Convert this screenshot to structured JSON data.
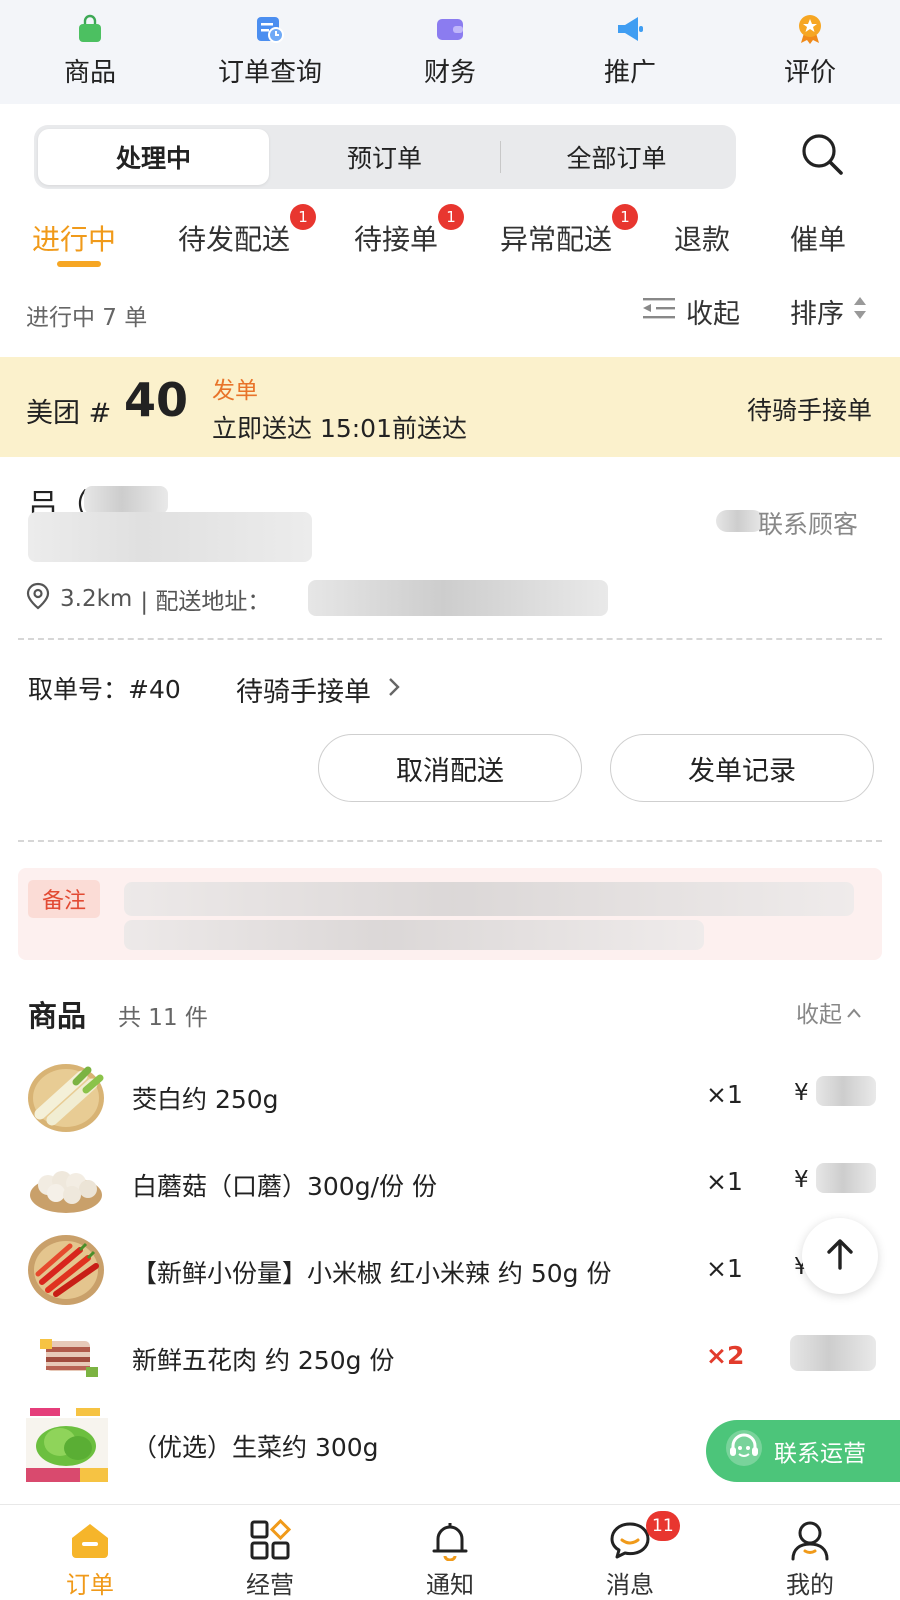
{
  "top_nav": [
    {
      "label": "商品",
      "icon": "bag-icon",
      "color": "#4cc061"
    },
    {
      "label": "订单查询",
      "icon": "order-search-icon",
      "color": "#4b8ef0"
    },
    {
      "label": "财务",
      "icon": "wallet-icon",
      "color": "#8b7cf0"
    },
    {
      "label": "推广",
      "icon": "megaphone-icon",
      "color": "#3f9df2"
    },
    {
      "label": "评价",
      "icon": "star-medal-icon",
      "color": "#f6a623"
    }
  ],
  "segment": {
    "items": [
      "处理中",
      "预订单",
      "全部订单"
    ],
    "active": "处理中"
  },
  "status_tabs": [
    {
      "label": "进行中",
      "badge": "",
      "active": true
    },
    {
      "label": "待发配送",
      "badge": "1"
    },
    {
      "label": "待接单",
      "badge": "1"
    },
    {
      "label": "异常配送",
      "badge": "1"
    },
    {
      "label": "退款",
      "badge": ""
    },
    {
      "label": "催单",
      "badge": ""
    }
  ],
  "summary": {
    "count_text": "进行中 7 单",
    "collapse_label": "收起",
    "sort_label": "排序"
  },
  "order": {
    "platform": "美团 #",
    "number": "40",
    "dispatch_label": "发单",
    "deliver_text": "立即送达 15:01前送达",
    "status": "待骑手接单",
    "customer_name": "吕（",
    "contact_label": "联系顾客",
    "distance": "3.2km",
    "address_label": "| 配送地址：",
    "pickup_label": "取单号：#40",
    "pickup_status": "待骑手接单",
    "cancel_label": "取消配送",
    "record_label": "发单记录",
    "note_tag": "备注"
  },
  "goods": {
    "title": "商品",
    "count": "共 11 件",
    "collapse_label": "收起",
    "items": [
      {
        "name": "茭白约 250g",
        "qty": "×1",
        "price": "¥",
        "highlight": false
      },
      {
        "name": "白蘑菇（口蘑）300g/份 份",
        "qty": "×1",
        "price": "¥",
        "highlight": false
      },
      {
        "name": "【新鲜小份量】小米椒 红小米辣 约 50g 份",
        "qty": "×1",
        "price": "¥",
        "highlight": false
      },
      {
        "name": "新鲜五花肉 约 250g 份",
        "qty": "×2",
        "price": "¥",
        "highlight": true
      },
      {
        "name": "（优选）生菜约 300g",
        "qty": "",
        "price": "",
        "highlight": false
      }
    ]
  },
  "contact_ops_label": "联系运营",
  "bottom_nav": [
    {
      "label": "订单",
      "icon": "order-home-icon",
      "active": true,
      "badge": ""
    },
    {
      "label": "经营",
      "icon": "grid-icon",
      "active": false,
      "badge": ""
    },
    {
      "label": "通知",
      "icon": "bell-icon",
      "active": false,
      "badge": ""
    },
    {
      "label": "消息",
      "icon": "chat-icon",
      "active": false,
      "badge": "11"
    },
    {
      "label": "我的",
      "icon": "user-icon",
      "active": false,
      "badge": ""
    }
  ],
  "colors": {
    "accent": "#f09a1a",
    "badge": "#e8362f",
    "banner": "#fbf1cc",
    "ops_green": "#4cc57a"
  }
}
